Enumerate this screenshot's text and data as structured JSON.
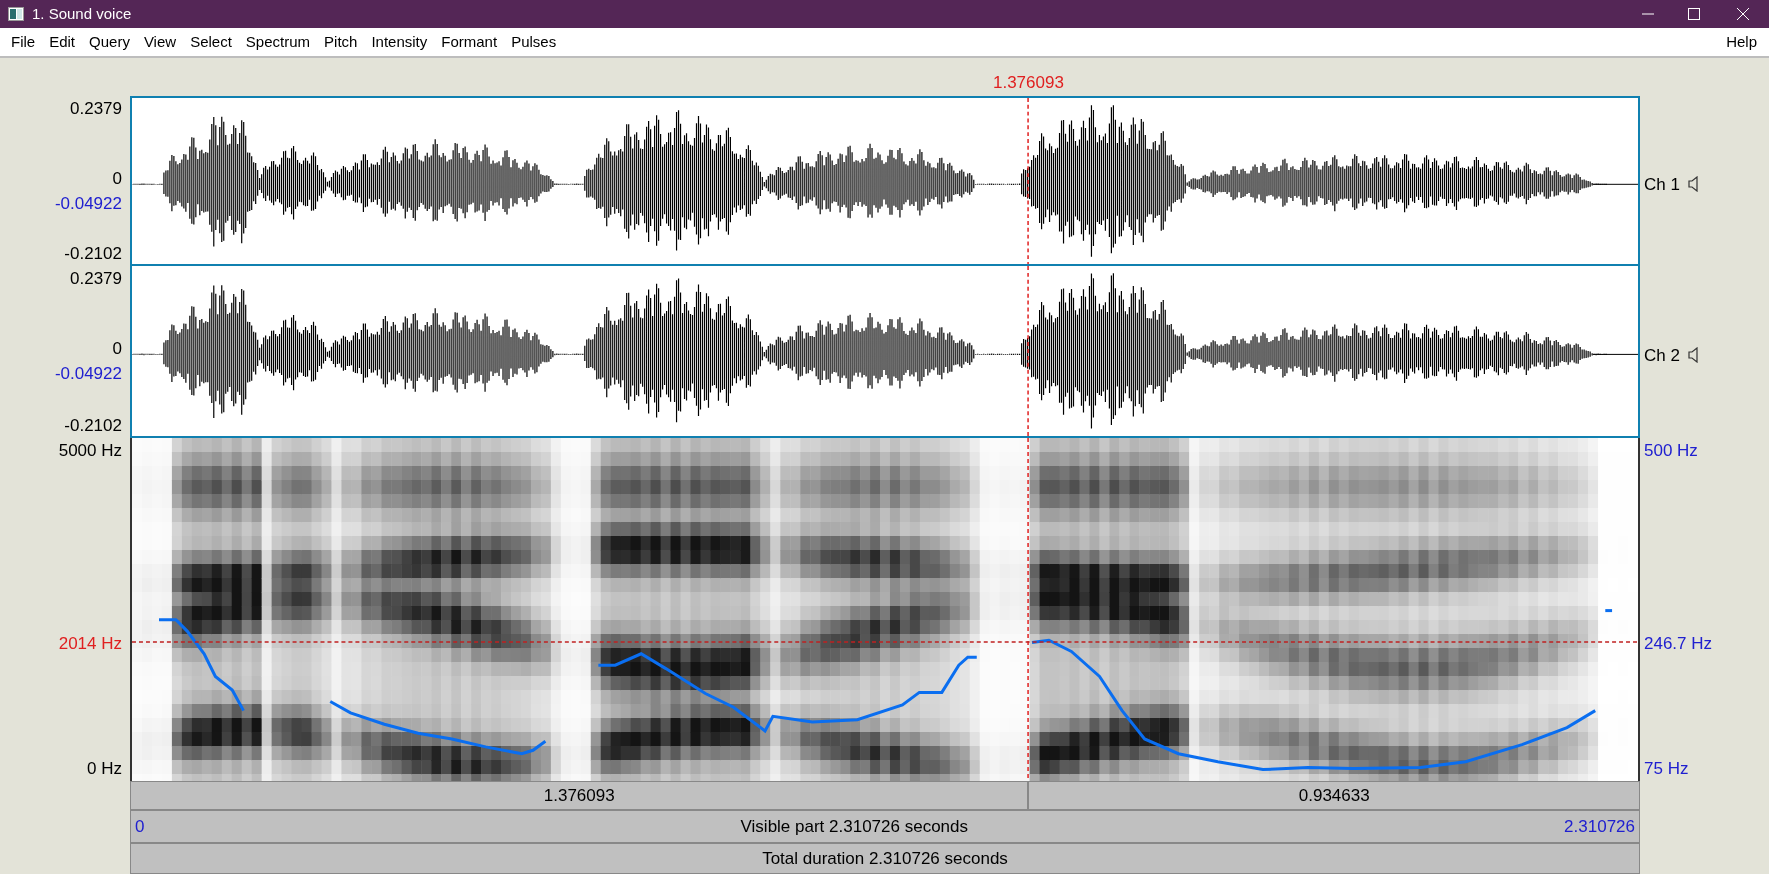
{
  "window": {
    "title": "1. Sound voice"
  },
  "menu": [
    "File",
    "Edit",
    "Query",
    "View",
    "Select",
    "Spectrum",
    "Pitch",
    "Intensity",
    "Formant",
    "Pulses"
  ],
  "help_menu": "Help",
  "cursor": {
    "time": "1.376093"
  },
  "channels": [
    {
      "name": "Ch 1",
      "ymax": "0.2379",
      "zero": "0",
      "cursor_value": "-0.04922",
      "ymin": "-0.2102"
    },
    {
      "name": "Ch 2",
      "ymax": "0.2379",
      "zero": "0",
      "cursor_value": "-0.04922",
      "ymin": "-0.2102"
    }
  ],
  "spectrogram": {
    "fmax": "5000 Hz",
    "cursor_freq": "2014 Hz",
    "fmin": "0 Hz",
    "pitch_max": "500 Hz",
    "pitch_cursor": "246.7 Hz",
    "pitch_min": "75 Hz"
  },
  "time_bars": {
    "left_part": "1.376093",
    "right_part": "0.934633",
    "start": "0",
    "visible": "Visible part 2.310726 seconds",
    "end": "2.310726",
    "total": "Total duration 2.310726 seconds"
  }
}
